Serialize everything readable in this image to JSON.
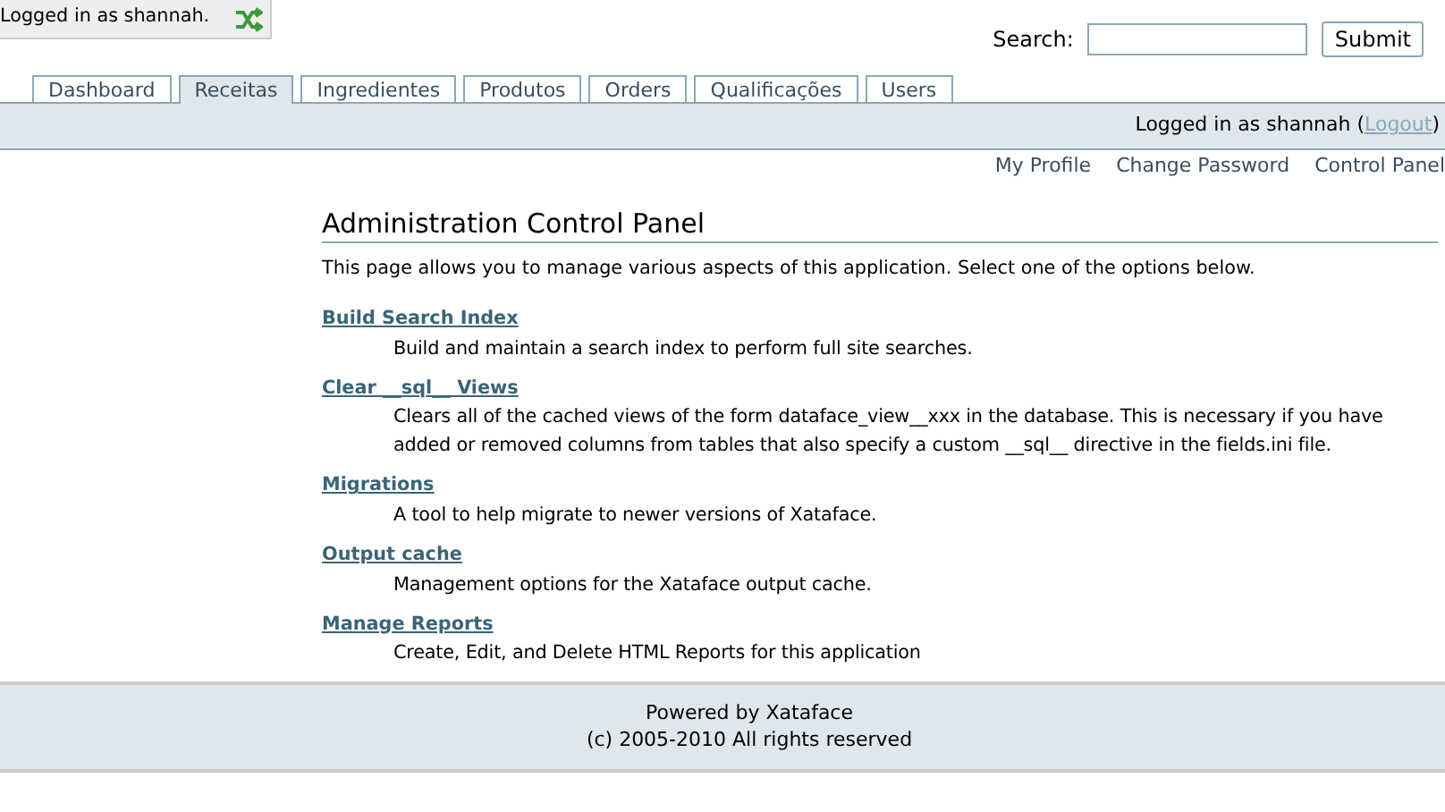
{
  "login_badge": {
    "text": "Logged in as shannah."
  },
  "search": {
    "label": "Search:",
    "button": "Submit"
  },
  "tabs": [
    {
      "label": "Dashboard",
      "selected": false
    },
    {
      "label": "Receitas",
      "selected": true
    },
    {
      "label": "Ingredientes",
      "selected": false
    },
    {
      "label": "Produtos",
      "selected": false
    },
    {
      "label": "Orders",
      "selected": false
    },
    {
      "label": "Qualificações",
      "selected": false
    },
    {
      "label": "Users",
      "selected": false
    }
  ],
  "status_bar": {
    "text": "Logged in as shannah (",
    "link": "Logout",
    "suffix": ")"
  },
  "user_links": [
    "My Profile",
    "Change Password",
    "Control Panel"
  ],
  "page": {
    "title": "Administration Control Panel",
    "intro": "This page allows you to manage various aspects of this application. Select one of the options below.",
    "options": [
      {
        "link": "Build Search Index",
        "description": "Build and maintain a search index to perform full site searches."
      },
      {
        "link": "Clear __sql__ Views",
        "description": "Clears all of the cached views of the form dataface_view__xxx in the database. This is necessary if you have added or removed columns from tables that also specify a custom __sql__ directive in the fields.ini file."
      },
      {
        "link": "Migrations",
        "description": "A tool to help migrate to newer versions of Xataface."
      },
      {
        "link": "Output cache",
        "description": "Management options for the Xataface output cache."
      },
      {
        "link": "Manage Reports",
        "description": "Create, Edit, and Delete HTML Reports for this application"
      }
    ]
  },
  "footer": [
    "Powered by Xataface",
    "(c) 2005-2010 All rights reserved"
  ]
}
